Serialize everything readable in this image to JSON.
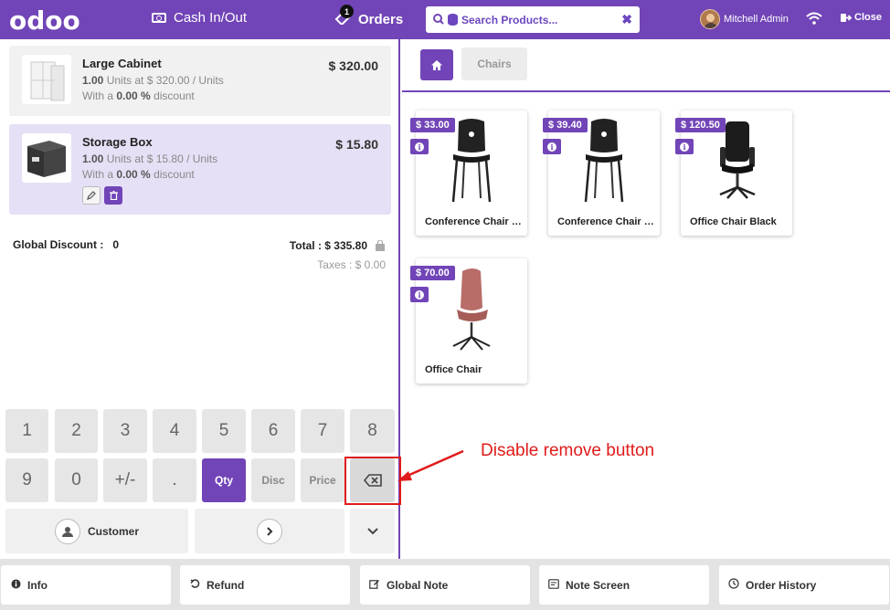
{
  "topbar": {
    "logo": "odoo",
    "cash_label": "Cash In/Out",
    "orders_label": "Orders",
    "orders_count": "1",
    "search_placeholder": "Search Products...",
    "user_name": "Mitchell Admin",
    "close_label": "Close"
  },
  "orderlines": [
    {
      "name": "Large Cabinet",
      "qty": "1.00",
      "unit_text": "Units at $ 320.00 / Units",
      "discount_prefix": "With a",
      "discount": "0.00 %",
      "discount_suffix": "discount",
      "price": "$ 320.00"
    },
    {
      "name": "Storage Box",
      "qty": "1.00",
      "unit_text": "Units at $ 15.80 / Units",
      "discount_prefix": "With a",
      "discount": "0.00 %",
      "discount_suffix": "discount",
      "price": "$ 15.80"
    }
  ],
  "summary": {
    "global_discount_label": "Global Discount :",
    "global_discount_value": "0",
    "total": "Total : $ 335.80",
    "taxes": "Taxes : $ 0.00"
  },
  "numpad": {
    "row1": [
      "1",
      "2",
      "3",
      "4",
      "5",
      "6",
      "7",
      "8"
    ],
    "row2": [
      "9",
      "0",
      "+/-",
      "."
    ],
    "qty": "Qty",
    "disc": "Disc",
    "price": "Price",
    "customer": "Customer"
  },
  "category": {
    "current": "Chairs"
  },
  "products": [
    {
      "price": "$ 33.00",
      "name": "Conference Chair (Aluminium)"
    },
    {
      "price": "$ 39.40",
      "name": "Conference Chair (Steel)"
    },
    {
      "price": "$ 120.50",
      "name": "Office Chair Black"
    },
    {
      "price": "$ 70.00",
      "name": "Office Chair"
    }
  ],
  "annotation": "Disable remove button",
  "controls": [
    "Info",
    "Refund",
    "Global Note",
    "Note Screen",
    "Order History"
  ],
  "colors": {
    "brand": "#7145b7",
    "annotation": "#e01b1b"
  }
}
